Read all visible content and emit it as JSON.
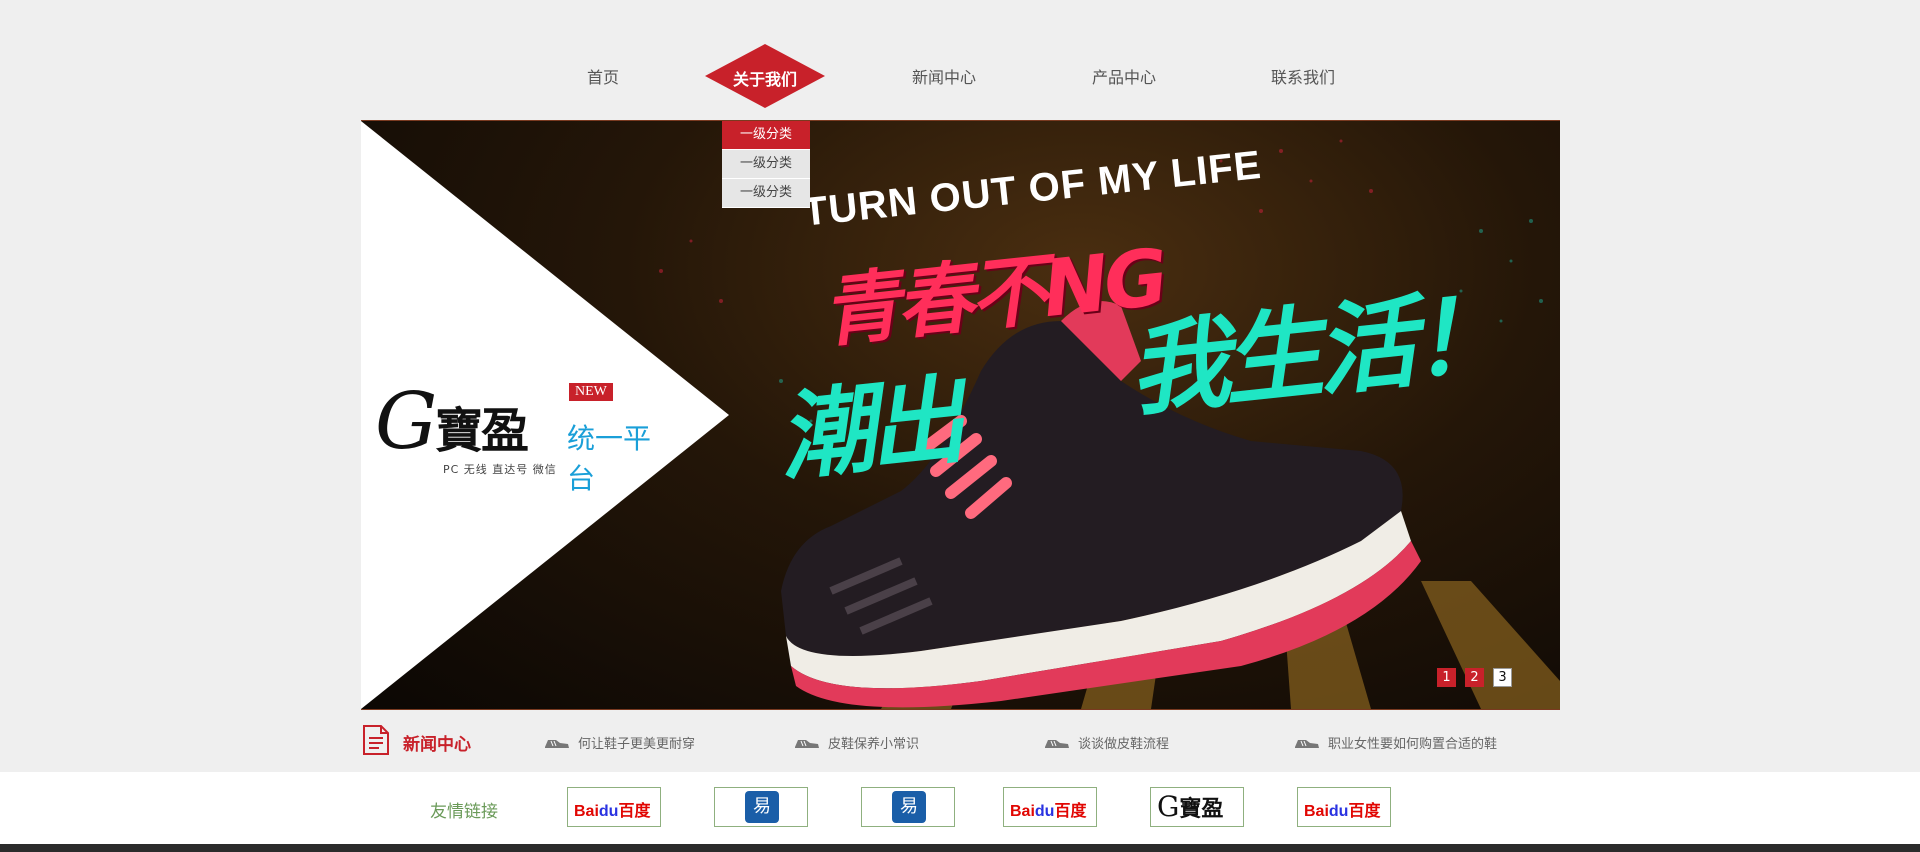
{
  "nav": {
    "items": [
      {
        "label": "首页"
      },
      {
        "label": "关于我们",
        "active": true
      },
      {
        "label": "新闻中心"
      },
      {
        "label": "产品中心"
      },
      {
        "label": "联系我们"
      }
    ],
    "dropdown": [
      "一级分类",
      "一级分类",
      "一级分类"
    ],
    "accent_color": "#c8212a"
  },
  "banner": {
    "headline_en": "TURN OUT OF MY LIFE",
    "headline_red": "青春不NG",
    "headline_teal_1": "潮出",
    "headline_teal_2": "我生活！",
    "logo": {
      "initial": "G",
      "name": "寶盈",
      "badge": "NEW",
      "platform": "统一平台",
      "sub": "PC 无线 直达号 微信"
    },
    "pagination": [
      "1",
      "2",
      "3"
    ],
    "active_page": "3"
  },
  "news": {
    "title": "新闻中心",
    "items": [
      "何让鞋子更美更耐穿",
      "皮鞋保养小常识",
      "谈谈做皮鞋流程",
      "职业女性要如何购置合适的鞋"
    ]
  },
  "links": {
    "label": "友情链接",
    "items": [
      {
        "type": "baidu",
        "text_a": "Bai",
        "text_b": "du",
        "text_c": "百度"
      },
      {
        "type": "yi",
        "text": "易"
      },
      {
        "type": "yi",
        "text": "易"
      },
      {
        "type": "baidu",
        "text_a": "Bai",
        "text_b": "du",
        "text_c": "百度"
      },
      {
        "type": "gb",
        "text_a": "G",
        "text_b": "寶盈"
      },
      {
        "type": "baidu",
        "text_a": "Bai",
        "text_b": "du",
        "text_c": "百度"
      }
    ]
  }
}
